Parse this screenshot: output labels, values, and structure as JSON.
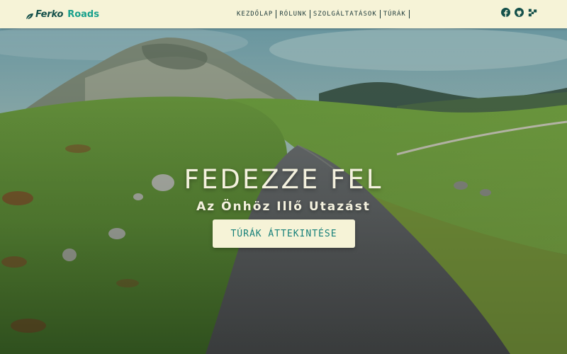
{
  "brand": {
    "name_part1": "Ferko",
    "name_part2": "Roads",
    "icon": "leaf-icon"
  },
  "nav": {
    "items": [
      "KEZDŐLAP",
      "RÓLUNK",
      "SZOLGÁLTATÁSOK",
      "TÚRÁK"
    ]
  },
  "socials": [
    {
      "name": "facebook-icon"
    },
    {
      "name": "github-icon"
    },
    {
      "name": "codepen-icon"
    }
  ],
  "hero": {
    "title": "FEDEZZE FEL",
    "subtitle": "Az Önhöz Illő Utazást",
    "cta_label": "TÚRÁK ÁTTEKINTÉSE"
  },
  "colors": {
    "header_bg": "#f6f3d7",
    "brand_dark": "#14504a",
    "brand_accent": "#17a08c",
    "nav_text": "#1f3b3b",
    "hero_text": "#f4f1de",
    "button_text": "#17807a"
  }
}
